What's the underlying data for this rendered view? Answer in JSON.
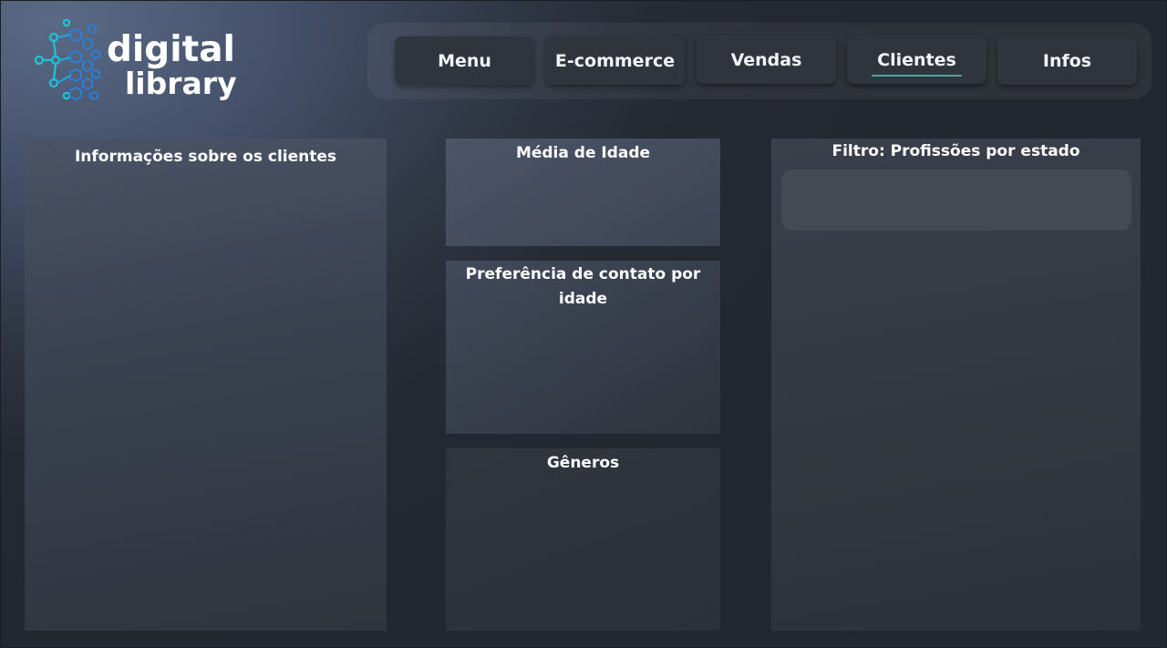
{
  "logo": {
    "line1": "digital",
    "line2": "library",
    "colors": {
      "teal": "#1fc4d6",
      "blue": "#2a6fc9",
      "text": "#ffffff"
    }
  },
  "nav": {
    "items": [
      {
        "label": "Menu",
        "active": false
      },
      {
        "label": "E-commerce",
        "active": false
      },
      {
        "label": "Vendas",
        "active": false
      },
      {
        "label": "Clientes",
        "active": true
      },
      {
        "label": "Infos",
        "active": false
      }
    ],
    "accent": "#4fa6a0"
  },
  "panels": {
    "clientes_info": {
      "title": "Informações sobre os clientes"
    },
    "media_idade": {
      "title": "Média de Idade"
    },
    "preferencia": {
      "title": "Preferência de contato por idade"
    },
    "generos": {
      "title": "Gêneros"
    },
    "filtro": {
      "title": "Filtro: Profissões por estado"
    }
  }
}
